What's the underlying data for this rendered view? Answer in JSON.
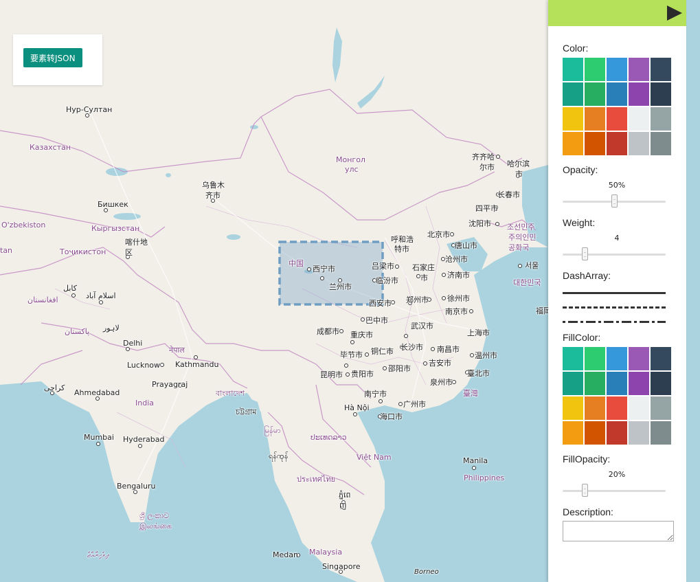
{
  "toolbar": {
    "to_json_label": "要素转JSON"
  },
  "map": {
    "places": [
      {
        "id": "nur-sultan",
        "label": "Нур-Султан",
        "kind": "city"
      },
      {
        "id": "kazakhstan",
        "label": "Казахстан",
        "kind": "country"
      },
      {
        "id": "mongolia1",
        "label": "Монгол",
        "kind": "country"
      },
      {
        "id": "mongolia2",
        "label": "улс",
        "kind": "country"
      },
      {
        "id": "urumqi1",
        "label": "乌鲁木",
        "kind": "city"
      },
      {
        "id": "urumqi2",
        "label": "齐市",
        "kind": "city"
      },
      {
        "id": "bishkek",
        "label": "Бишкек",
        "kind": "city"
      },
      {
        "id": "uzbekistan",
        "label": "O'zbekiston",
        "kind": "country"
      },
      {
        "id": "kyrgyzstan",
        "label": "Кыргызстан",
        "kind": "country"
      },
      {
        "id": "tajikistan",
        "label": "Тоҷикистон",
        "kind": "country"
      },
      {
        "id": "tan",
        "label": "tan",
        "kind": "country"
      },
      {
        "id": "kashgar1",
        "label": "喀什地",
        "kind": "city"
      },
      {
        "id": "kashgar2",
        "label": "区",
        "kind": "city"
      },
      {
        "id": "kabul",
        "label": "کابل",
        "kind": "city"
      },
      {
        "id": "islamabad",
        "label": "اسلام آباد",
        "kind": "city"
      },
      {
        "id": "afghanistan",
        "label": "افغانستان",
        "kind": "country"
      },
      {
        "id": "lahore",
        "label": "لاہور",
        "kind": "city"
      },
      {
        "id": "pakistan",
        "label": "پاکستان",
        "kind": "country"
      },
      {
        "id": "delhi",
        "label": "Delhi",
        "kind": "city"
      },
      {
        "id": "nepal",
        "label": "नेपाल",
        "kind": "country"
      },
      {
        "id": "kathmandu",
        "label": "Kathmandu",
        "kind": "city"
      },
      {
        "id": "lucknow",
        "label": "Lucknow",
        "kind": "city"
      },
      {
        "id": "prayagraj",
        "label": "Prayagraj",
        "kind": "city"
      },
      {
        "id": "karachi",
        "label": "کراچی",
        "kind": "city"
      },
      {
        "id": "ahmedabad",
        "label": "Ahmedabad",
        "kind": "city"
      },
      {
        "id": "india",
        "label": "India",
        "kind": "country"
      },
      {
        "id": "bangladesh",
        "label": "বাংলাদেশ",
        "kind": "country"
      },
      {
        "id": "chittagong",
        "label": "চট্টগ্রাম",
        "kind": "city"
      },
      {
        "id": "mumbai",
        "label": "Mumbai",
        "kind": "city"
      },
      {
        "id": "hyderabad",
        "label": "Hyderabad",
        "kind": "city"
      },
      {
        "id": "bengaluru",
        "label": "Bengaluru",
        "kind": "city"
      },
      {
        "id": "srilanka1",
        "label": "ශ්‍රී ලංකාව",
        "kind": "country"
      },
      {
        "id": "srilanka2",
        "label": "இலங்கை",
        "kind": "country"
      },
      {
        "id": "maldives",
        "label": "ދިވެހިރާއްޖެ",
        "kind": "country"
      },
      {
        "id": "myanmar",
        "label": "မြန်မာ",
        "kind": "country"
      },
      {
        "id": "yangon",
        "label": "ရန်ကုန်",
        "kind": "city"
      },
      {
        "id": "laos",
        "label": "ປະເທດລາວ",
        "kind": "country"
      },
      {
        "id": "hanoi",
        "label": "Hà Nội",
        "kind": "city"
      },
      {
        "id": "vietnam",
        "label": "Việt Nam",
        "kind": "country"
      },
      {
        "id": "thailand",
        "label": "ประเทศไทย",
        "kind": "country"
      },
      {
        "id": "phnompenh1",
        "label": "ភ្នំពេ",
        "kind": "city"
      },
      {
        "id": "phnompenh2",
        "label": "ញ",
        "kind": "city"
      },
      {
        "id": "medan",
        "label": "Medan",
        "kind": "city"
      },
      {
        "id": "malaysia",
        "label": "Malaysia",
        "kind": "country"
      },
      {
        "id": "singapore",
        "label": "Singapore",
        "kind": "city"
      },
      {
        "id": "borneo",
        "label": "Borneo",
        "kind": "italic"
      },
      {
        "id": "manila",
        "label": "Manila",
        "kind": "city"
      },
      {
        "id": "philippines",
        "label": "Philippines",
        "kind": "country"
      },
      {
        "id": "china",
        "label": "中国",
        "kind": "country"
      },
      {
        "id": "xining",
        "label": "西宁市",
        "kind": "city"
      },
      {
        "id": "lanzhou",
        "label": "兰州市",
        "kind": "city"
      },
      {
        "id": "lvliang",
        "label": "吕梁市",
        "kind": "city"
      },
      {
        "id": "linfen",
        "label": "临汾市",
        "kind": "city"
      },
      {
        "id": "xian",
        "label": "西安市",
        "kind": "city"
      },
      {
        "id": "hohhot1",
        "label": "呼和浩",
        "kind": "city"
      },
      {
        "id": "hohhot2",
        "label": "特市",
        "kind": "city"
      },
      {
        "id": "beijing",
        "label": "北京市",
        "kind": "city"
      },
      {
        "id": "tangshan",
        "label": "唐山市",
        "kind": "city"
      },
      {
        "id": "shijiazhuang1",
        "label": "石家庄",
        "kind": "city"
      },
      {
        "id": "shijiazhuang2",
        "label": "市",
        "kind": "city"
      },
      {
        "id": "cangzhou",
        "label": "沧州市",
        "kind": "city"
      },
      {
        "id": "jinan",
        "label": "济南市",
        "kind": "city"
      },
      {
        "id": "zhengzhou",
        "label": "郑州市",
        "kind": "city"
      },
      {
        "id": "xuzhou",
        "label": "徐州市",
        "kind": "city"
      },
      {
        "id": "nanjing",
        "label": "南京市",
        "kind": "city"
      },
      {
        "id": "bazhong",
        "label": "巴中市",
        "kind": "city"
      },
      {
        "id": "chengdu",
        "label": "成都市",
        "kind": "city"
      },
      {
        "id": "chongqing",
        "label": "重庆市",
        "kind": "city"
      },
      {
        "id": "wuhan",
        "label": "武汉市",
        "kind": "city"
      },
      {
        "id": "shanghai",
        "label": "上海市",
        "kind": "city"
      },
      {
        "id": "bijie",
        "label": "毕节市",
        "kind": "city"
      },
      {
        "id": "tongren",
        "label": "铜仁市",
        "kind": "city"
      },
      {
        "id": "changsha",
        "label": "长沙市",
        "kind": "city"
      },
      {
        "id": "nanchang",
        "label": "南昌市",
        "kind": "city"
      },
      {
        "id": "wenzhou",
        "label": "温州市",
        "kind": "city"
      },
      {
        "id": "kunming",
        "label": "昆明市",
        "kind": "city"
      },
      {
        "id": "guiyang",
        "label": "贵阳市",
        "kind": "city"
      },
      {
        "id": "shaoyang",
        "label": "邵阳市",
        "kind": "city"
      },
      {
        "id": "jian",
        "label": "吉安市",
        "kind": "city"
      },
      {
        "id": "taipei",
        "label": "臺北市",
        "kind": "city"
      },
      {
        "id": "quanzhou",
        "label": "泉州市",
        "kind": "city"
      },
      {
        "id": "taiwan",
        "label": "臺灣",
        "kind": "country"
      },
      {
        "id": "nanning",
        "label": "南宁市",
        "kind": "city"
      },
      {
        "id": "guangzhou",
        "label": "广州市",
        "kind": "city"
      },
      {
        "id": "haikou",
        "label": "海口市",
        "kind": "city"
      },
      {
        "id": "qiqihar1",
        "label": "齐齐哈",
        "kind": "city"
      },
      {
        "id": "qiqihar2",
        "label": "尔市",
        "kind": "city"
      },
      {
        "id": "harbin1",
        "label": "哈尔滨",
        "kind": "city"
      },
      {
        "id": "harbin2",
        "label": "市",
        "kind": "city"
      },
      {
        "id": "changchun",
        "label": "长春市",
        "kind": "city"
      },
      {
        "id": "siping",
        "label": "四平市",
        "kind": "city"
      },
      {
        "id": "shenyang",
        "label": "沈阳市",
        "kind": "city"
      },
      {
        "id": "nk1",
        "label": "조선민주",
        "kind": "country"
      },
      {
        "id": "nk2",
        "label": "주의인민",
        "kind": "country"
      },
      {
        "id": "nk3",
        "label": "공화국",
        "kind": "country"
      },
      {
        "id": "seoul",
        "label": "서울",
        "kind": "city"
      },
      {
        "id": "sk",
        "label": "대한민국",
        "kind": "country"
      },
      {
        "id": "fuku",
        "label": "福岡",
        "kind": "city"
      }
    ]
  },
  "panel": {
    "toggle_icon": "play-arrow-icon",
    "color_label": "Color:",
    "colors": [
      "#1abc9c",
      "#2ecc71",
      "#3498db",
      "#9b59b6",
      "#34495e",
      "#16a085",
      "#27ae60",
      "#2980b9",
      "#8e44ad",
      "#2c3e50",
      "#f1c40f",
      "#e67e22",
      "#e74c3c",
      "#ecf0f1",
      "#95a5a6",
      "#f39c12",
      "#d35400",
      "#c0392b",
      "#bdc3c7",
      "#7f8c8d"
    ],
    "opacity_label": "Opacity:",
    "opacity_value": "50%",
    "opacity_fraction": 0.5,
    "weight_label": "Weight:",
    "weight_value": "4",
    "weight_fraction": 0.2,
    "dasharray_label": "DashArray:",
    "fillcolor_label": "FillColor:",
    "fillcolors": [
      "#1abc9c",
      "#2ecc71",
      "#3498db",
      "#9b59b6",
      "#34495e",
      "#16a085",
      "#27ae60",
      "#2980b9",
      "#8e44ad",
      "#2c3e50",
      "#f1c40f",
      "#e67e22",
      "#e74c3c",
      "#ecf0f1",
      "#95a5a6",
      "#f39c12",
      "#d35400",
      "#c0392b",
      "#bdc3c7",
      "#7f8c8d"
    ],
    "fillopacity_label": "FillOpacity:",
    "fillopacity_value": "20%",
    "fillopacity_fraction": 0.2,
    "description_label": "Description:",
    "description_value": ""
  }
}
